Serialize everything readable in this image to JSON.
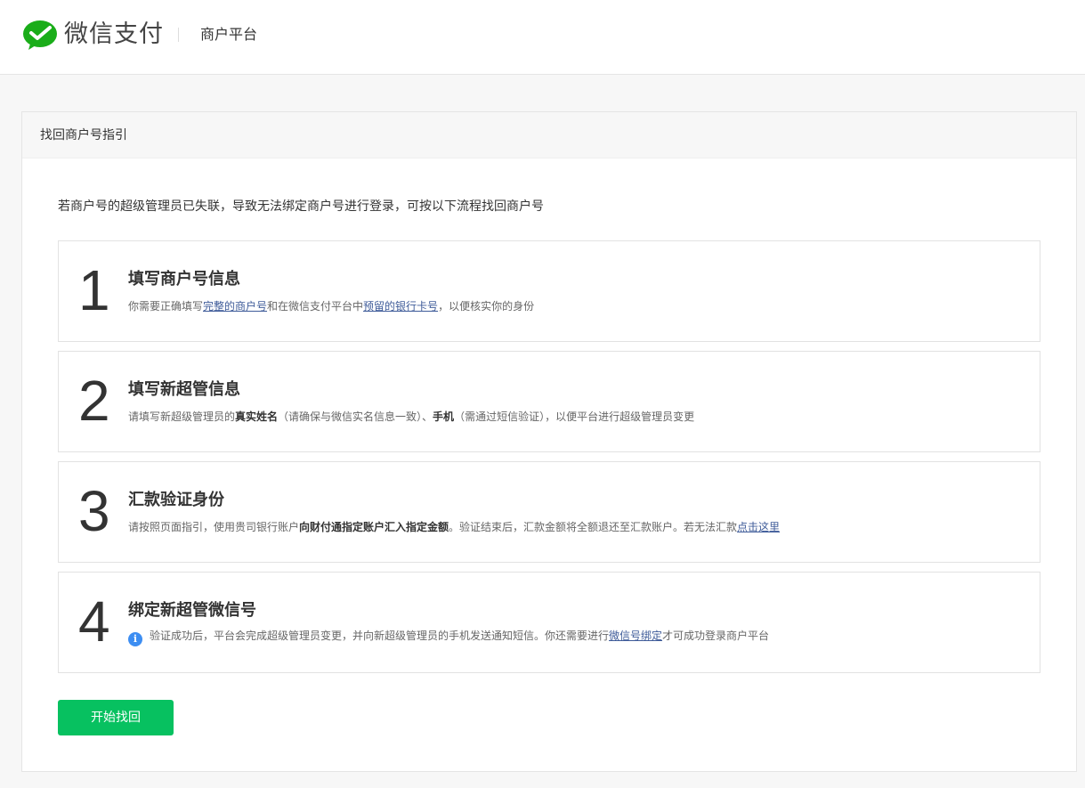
{
  "header": {
    "brand": "微信支付",
    "platform": "商户平台"
  },
  "panel": {
    "title": "找回商户号指引",
    "intro": "若商户号的超级管理员已失联，导致无法绑定商户号进行登录，可按以下流程找回商户号"
  },
  "steps": [
    {
      "number": "1",
      "title": "填写商户号信息",
      "desc": {
        "t1": "你需要正确填写",
        "link1": "完整的商户号",
        "t2": "和在微信支付平台中",
        "link2": "预留的银行卡号",
        "t3": "，以便核实你的身份"
      }
    },
    {
      "number": "2",
      "title": "填写新超管信息",
      "desc": {
        "t1": "请填写新超级管理员的",
        "b1": "真实姓名",
        "t2": "（请确保与微信实名信息一致）、",
        "b2": "手机",
        "t3": "（需通过短信验证），以便平台进行超级管理员变更"
      }
    },
    {
      "number": "3",
      "title": "汇款验证身份",
      "desc": {
        "t1": "请按照页面指引，使用贵司银行账户",
        "b1": "向财付通指定账户汇入指定金额",
        "t2": "。验证结束后，汇款金额将全额退还至汇款账户。若无法汇款",
        "link1": "点击这里"
      }
    },
    {
      "number": "4",
      "title": "绑定新超管微信号",
      "desc": {
        "icon": "info-icon",
        "t1": "验证成功后，平台会完成超级管理员变更，并向新超级管理员的手机发送通知短信。你还需要进行",
        "link1": "微信号绑定",
        "t2": "才可成功登录商户平台"
      }
    }
  ],
  "actions": {
    "start_label": "开始找回"
  },
  "colors": {
    "brand_green": "#07c160",
    "link": "#3e5b99",
    "info": "#3d8ef2"
  }
}
